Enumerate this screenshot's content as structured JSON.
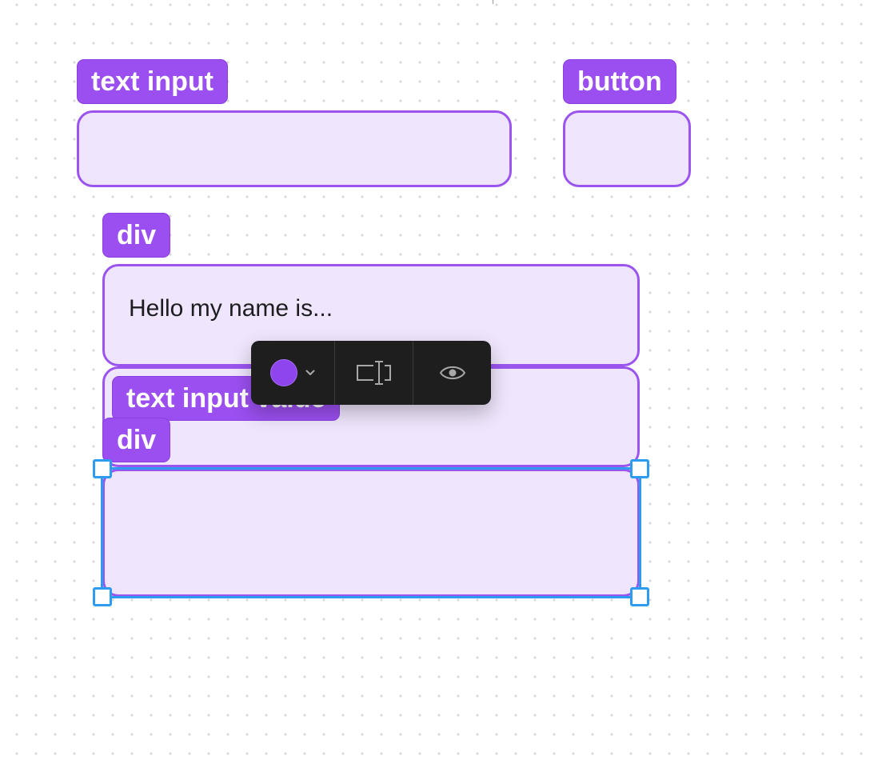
{
  "canvas": {
    "background": "#ffffff",
    "grid_dot_color": "#d6d6d6"
  },
  "colors": {
    "tag_fill": "#9b4ff0",
    "box_fill": "#efe5fc",
    "box_border": "#9b55ee",
    "selection": "#2d9bf0",
    "toolbar_bg": "#1e1e1e",
    "swatch": "#8e45ee"
  },
  "components": {
    "text_input_tag": "text input",
    "button_tag": "button",
    "div_tag_1": "div",
    "div_1_text": "Hello my name is...",
    "text_input_value_tag": "text input value",
    "div_tag_2": "div"
  },
  "toolbar": {
    "color_swatch_icon": "filled-circle",
    "color_dropdown_icon": "chevron-down-icon",
    "resize_icon": "text-resize-icon",
    "visibility_icon": "eye-icon"
  }
}
